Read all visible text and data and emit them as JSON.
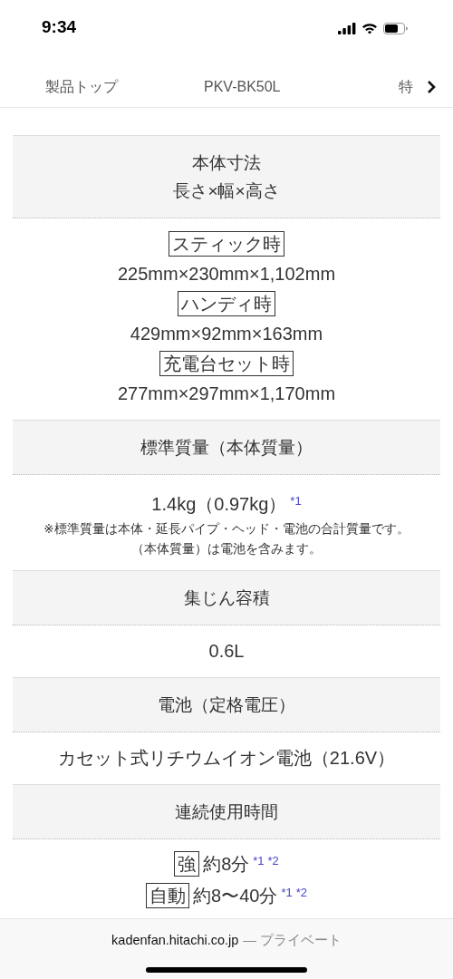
{
  "status_bar": {
    "time": "9:34"
  },
  "nav": {
    "items": [
      {
        "label": "製品トップ"
      },
      {
        "label": "PKV-BK50L"
      },
      {
        "label": "特"
      }
    ]
  },
  "specs": [
    {
      "header": [
        "本体寸法",
        "長さ×幅×高さ"
      ],
      "lines": [
        {
          "kind": "line",
          "tag": "スティック時"
        },
        {
          "kind": "line",
          "text": "225mm×230mm×1,102mm"
        },
        {
          "kind": "line",
          "tag": "ハンディ時"
        },
        {
          "kind": "line",
          "text": "429mm×92mm×163mm"
        },
        {
          "kind": "line",
          "tag": "充電台セット時"
        },
        {
          "kind": "line",
          "text": "277mm×297mm×1,170mm"
        }
      ]
    },
    {
      "header": [
        "標準質量（本体質量）"
      ],
      "lines": [
        {
          "kind": "line",
          "text": "1.4kg（0.97kg）",
          "notes": [
            "*1"
          ]
        },
        {
          "kind": "remark",
          "text": "※標準質量は本体・延長パイプ・ヘッド・電池の合計質量です。（本体質量）は電池を含みます。"
        }
      ]
    },
    {
      "header": [
        "集じん容積"
      ],
      "lines": [
        {
          "kind": "line",
          "text": "0.6L"
        }
      ]
    },
    {
      "header": [
        "電池（定格電圧）"
      ],
      "lines": [
        {
          "kind": "line",
          "text": "カセット式リチウムイオン電池（21.6V）"
        }
      ]
    },
    {
      "header": [
        "連続使用時間"
      ],
      "lines": [
        {
          "kind": "line",
          "tag": "強",
          "text": "約8分",
          "notes": [
            "*1",
            "*2"
          ]
        },
        {
          "kind": "line",
          "tag": "自動",
          "text": "約8〜40分",
          "notes": [
            "*1",
            "*2"
          ]
        }
      ]
    }
  ],
  "browser_bar": {
    "domain": "kadenfan.hitachi.co.jp",
    "mode": "— プライベート"
  }
}
